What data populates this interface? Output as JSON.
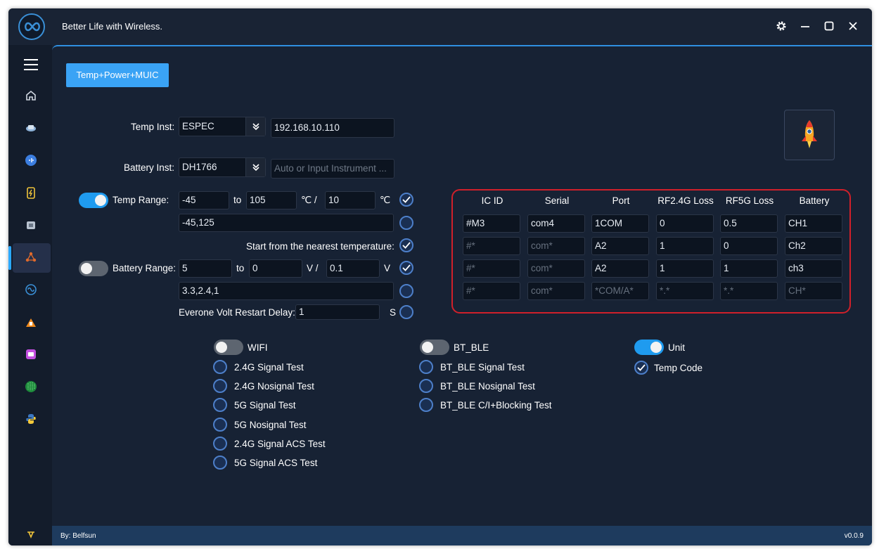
{
  "window": {
    "title": "Better Life with Wireless."
  },
  "sidebar": {
    "items": [
      {
        "name": "home-icon"
      },
      {
        "name": "chip-icon"
      },
      {
        "name": "audio-icon"
      },
      {
        "name": "battery-icon"
      },
      {
        "name": "module-icon"
      },
      {
        "name": "network-icon",
        "active": true
      },
      {
        "name": "wireless-icon"
      },
      {
        "name": "worker-icon"
      },
      {
        "name": "photo-icon"
      },
      {
        "name": "matrix-icon"
      },
      {
        "name": "python-icon"
      },
      {
        "name": "toolbox-icon"
      }
    ]
  },
  "tab": {
    "label": "Temp+Power+MUIC"
  },
  "temp_inst": {
    "label": "Temp Inst:",
    "value": "ESPEC",
    "address": "192.168.10.110"
  },
  "battery_inst": {
    "label": "Battery Inst:",
    "value": "DH1766",
    "address_placeholder": "Auto or Input Instrument ..."
  },
  "temp_range": {
    "enabled": true,
    "label": "Temp Range:",
    "from": "-45",
    "to_label": "to",
    "to": "105",
    "unit1": "℃ /",
    "step": "10",
    "unit2": "℃",
    "checked": true,
    "list": "-45,125",
    "list_checked": false,
    "nearest_label": "Start from the nearest temperature:",
    "nearest_checked": true
  },
  "battery_range": {
    "enabled": false,
    "label": "Battery Range:",
    "from": "5",
    "to_label": "to",
    "to": "0",
    "unit1": "V /",
    "step": "0.1",
    "unit2": "V",
    "checked": true,
    "list": "3.3,2.4,1",
    "list_checked": false,
    "restart_label": "Everone Volt Restart Delay:",
    "restart_value": "1",
    "restart_unit": "S",
    "restart_checked": false
  },
  "grid": {
    "headers": [
      "IC ID",
      "Serial",
      "Port",
      "RF2.4G Loss",
      "RF5G Loss",
      "Battery"
    ],
    "rows": [
      [
        {
          "v": "#M3"
        },
        {
          "v": "com4"
        },
        {
          "v": "1COM"
        },
        {
          "v": "0"
        },
        {
          "v": "0.5"
        },
        {
          "v": "CH1"
        }
      ],
      [
        {
          "v": "#*",
          "ph": true
        },
        {
          "v": "com*",
          "ph": true
        },
        {
          "v": "A2"
        },
        {
          "v": "1"
        },
        {
          "v": "0"
        },
        {
          "v": "Ch2"
        }
      ],
      [
        {
          "v": "#*",
          "ph": true
        },
        {
          "v": "com*",
          "ph": true
        },
        {
          "v": "A2"
        },
        {
          "v": "1"
        },
        {
          "v": "1"
        },
        {
          "v": "ch3"
        }
      ],
      [
        {
          "v": "#*",
          "ph": true
        },
        {
          "v": "com*",
          "ph": true
        },
        {
          "v": "*COM/A*",
          "ph": true
        },
        {
          "v": "*.*",
          "ph": true
        },
        {
          "v": "*.*",
          "ph": true
        },
        {
          "v": "CH*",
          "ph": true
        }
      ]
    ]
  },
  "wifi": {
    "label": "WIFI",
    "enabled": false,
    "tests": [
      "2.4G Signal Test",
      "2.4G Nosignal Test",
      "5G Signal Test",
      "5G Nosignal Test",
      "2.4G Signal ACS Test",
      "5G Signal ACS Test"
    ]
  },
  "bt": {
    "label": "BT_BLE",
    "enabled": false,
    "tests": [
      "BT_BLE Signal Test",
      "BT_BLE Nosignal Test",
      "BT_BLE C/I+Blocking Test"
    ]
  },
  "unit": {
    "label": "Unit",
    "enabled": true,
    "temp_code_label": "Temp Code",
    "temp_code_checked": true
  },
  "status": {
    "left": "By: Belfsun",
    "right": "v0.0.9"
  },
  "colors": {
    "accent": "#3aa3f5",
    "highlight_border": "#d0202a",
    "bg": "#172234"
  }
}
